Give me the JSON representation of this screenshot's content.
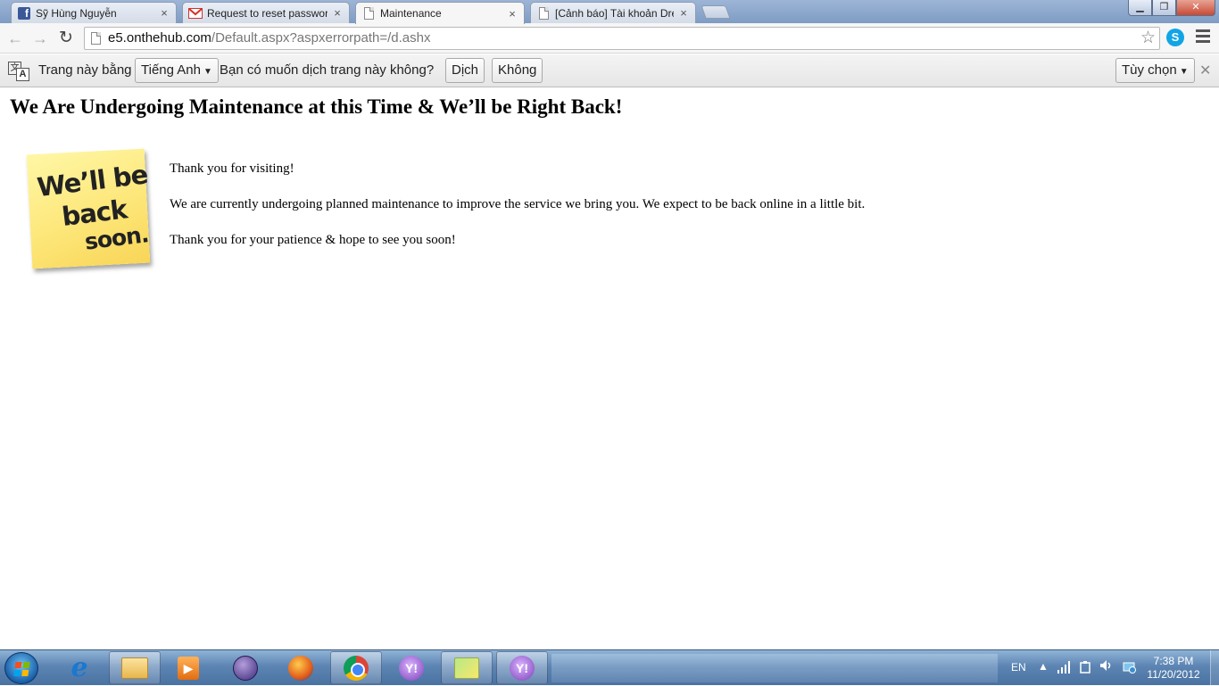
{
  "browser": {
    "tabs": [
      {
        "label": "Sỹ Hùng Nguyễn",
        "icon": "facebook-icon",
        "active": false
      },
      {
        "label": "Request to reset password",
        "icon": "gmail-icon",
        "active": false
      },
      {
        "label": "Maintenance",
        "icon": "page-icon",
        "active": true
      },
      {
        "label": "[Cảnh báo] Tài khoản Dre",
        "icon": "page-icon",
        "active": false
      }
    ],
    "close_glyph": "×",
    "window": {
      "min": "▁",
      "max": "❐",
      "close": "✕"
    },
    "nav": {
      "back": "←",
      "forward": "→",
      "reload": "↻"
    },
    "url_host": "e5.onthehub.com",
    "url_path": "/Default.aspx?aspxerrorpath=/d.ashx",
    "star": "☆"
  },
  "translate_bar": {
    "prefix": "Trang này bằng",
    "language": "Tiếng Anh",
    "question": "Bạn có muốn dịch trang này không?",
    "translate_button": "Dịch",
    "no_button": "Không",
    "options_button": "Tùy chọn",
    "close": "✕",
    "icon_back": "文",
    "icon_front": "A"
  },
  "page": {
    "title": "We Are Undergoing Maintenance at this Time & We’ll be Right Back!",
    "note_lines": [
      "We’ll be",
      "back",
      "soon."
    ],
    "paragraphs": [
      "Thank you for visiting!",
      "We are currently undergoing planned maintenance to improve the service we bring you. We expect to be back online in a little bit.",
      "Thank you for your patience & hope to see you soon!"
    ]
  },
  "taskbar": {
    "apps": [
      "internet-explorer",
      "file-explorer",
      "media-player",
      "eclipse",
      "firefox",
      "chrome",
      "yahoo-messenger",
      "sticky-notes",
      "yahoo-messenger-2"
    ],
    "tray": {
      "language": "EN"
    },
    "clock": {
      "time": "7:38 PM",
      "date": "11/20/2012"
    }
  }
}
